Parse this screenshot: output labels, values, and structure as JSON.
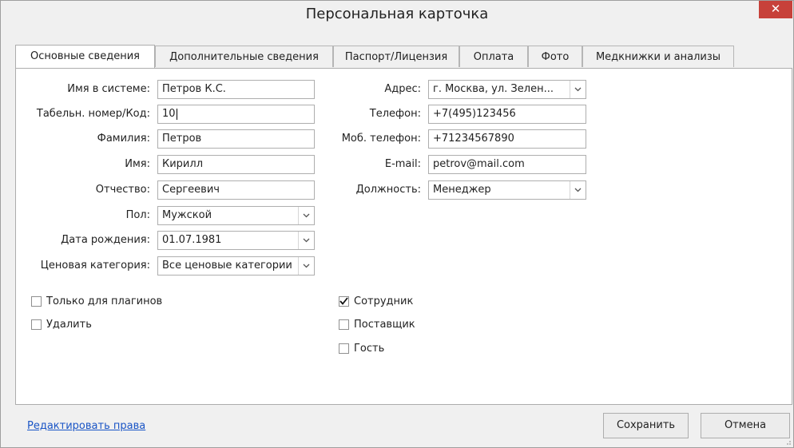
{
  "window": {
    "title": "Персональная карточка",
    "close_glyph": "✕"
  },
  "tabs": [
    {
      "label": "Основные сведения",
      "active": true
    },
    {
      "label": "Дополнительные сведения"
    },
    {
      "label": "Паспорт/Лицензия"
    },
    {
      "label": "Оплата"
    },
    {
      "label": "Фото"
    },
    {
      "label": "Медкнижки и анализы"
    }
  ],
  "left_fields": [
    {
      "label": "Имя в системе:",
      "value": "Петров К.С."
    },
    {
      "label": "Табельн. номер/Код:",
      "value": "10"
    },
    {
      "label": "Фамилия:",
      "value": "Петров"
    },
    {
      "label": "Имя:",
      "value": "Кирилл"
    },
    {
      "label": "Отчество:",
      "value": "Сергеевич"
    },
    {
      "label": "Пол:",
      "value": "Мужской"
    },
    {
      "label": "Дата рождения:",
      "value": "01.07.1981"
    },
    {
      "label": "Ценовая категория:",
      "value": "Все ценовые категории"
    }
  ],
  "right_fields": [
    {
      "label": "Адрес:",
      "value": "г. Москва, ул. Зелен..."
    },
    {
      "label": "Телефон:",
      "value": "+7(495)123456"
    },
    {
      "label": "Моб. телефон:",
      "value": "+71234567890"
    },
    {
      "label": "E-mail:",
      "value": "petrov@mail.com"
    },
    {
      "label": "Должность:",
      "value": "Менеджер"
    }
  ],
  "left_checks": [
    {
      "label": "Только для плагинов",
      "checked": false
    },
    {
      "label": "Удалить",
      "checked": false
    }
  ],
  "right_checks": [
    {
      "label": "Сотрудник",
      "checked": true
    },
    {
      "label": "Поставщик",
      "checked": false
    },
    {
      "label": "Гость",
      "checked": false
    }
  ],
  "footer": {
    "link": "Редактировать права",
    "save": "Сохранить",
    "cancel": "Отмена"
  },
  "colors": {
    "close_bg": "#c7413a",
    "link": "#1a55c6"
  }
}
